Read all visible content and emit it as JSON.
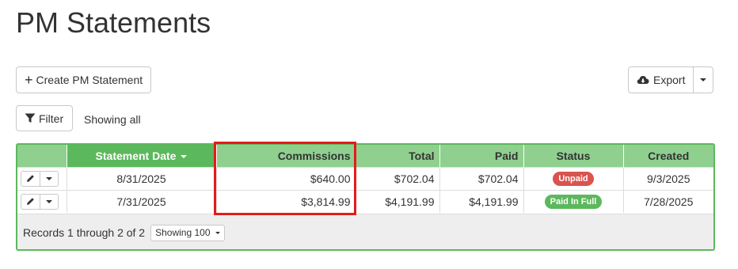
{
  "page": {
    "title": "PM Statements"
  },
  "toolbar": {
    "create_label": "Create PM Statement",
    "export_label": "Export",
    "filter_label": "Filter",
    "showing_text": "Showing all"
  },
  "table": {
    "columns": [
      "Statement Date",
      "Commissions",
      "Total",
      "Paid",
      "Status",
      "Created"
    ],
    "sorted_column": "Statement Date",
    "rows": [
      {
        "date": "8/31/2025",
        "commissions": "$640.00",
        "total": "$702.04",
        "paid": "$702.04",
        "status": "Unpaid",
        "created": "9/3/2025"
      },
      {
        "date": "7/31/2025",
        "commissions": "$3,814.99",
        "total": "$4,191.99",
        "paid": "$4,191.99",
        "status": "Paid In Full",
        "created": "7/28/2025"
      }
    ],
    "footer": {
      "records_text": "Records 1 through 2 of 2",
      "page_size_label": "Showing 100"
    }
  },
  "colors": {
    "header_green": "#8fd08f",
    "sorted_header_green": "#5cb85c",
    "border_green": "#5cb85c",
    "unpaid_badge": "#d9534f",
    "paid_badge": "#5cb85c",
    "highlight_red": "#e31b1b"
  }
}
